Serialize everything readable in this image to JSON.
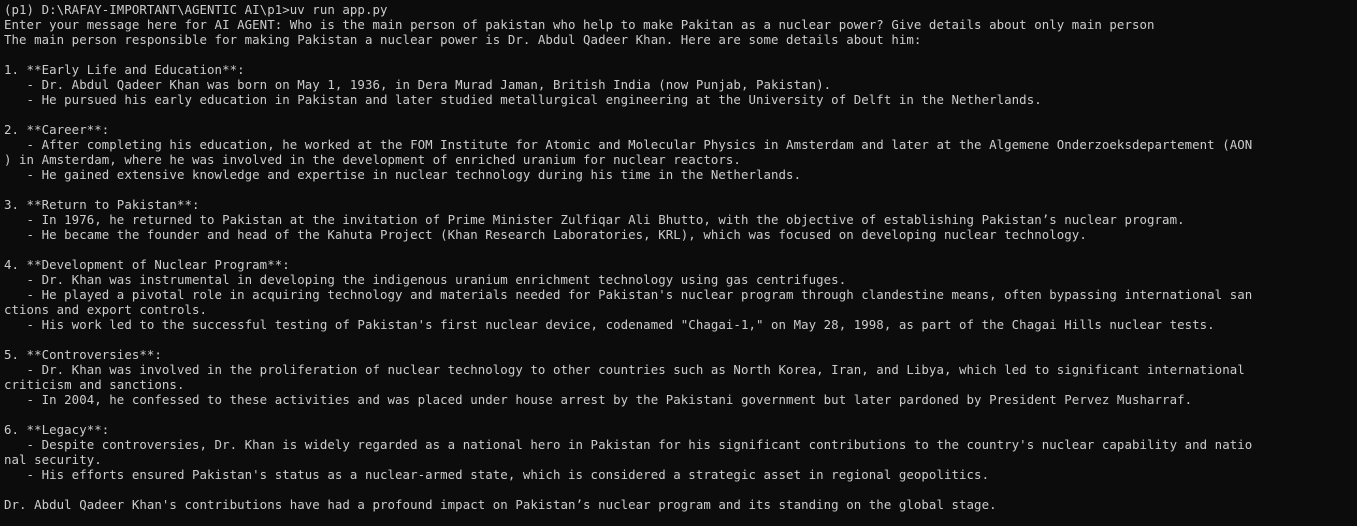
{
  "window": {
    "background": "#0c0c0c",
    "foreground": "#cccccc"
  },
  "lines": [
    "(p1) D:\\RAFAY-IMPORTANT\\AGENTIC AI\\p1>uv run app.py",
    "Enter your message here for AI AGENT: Who is the main person of pakistan who help to make Pakitan as a nuclear power? Give details about only main person",
    "The main person responsible for making Pakistan a nuclear power is Dr. Abdul Qadeer Khan. Here are some details about him:",
    "",
    "1. **Early Life and Education**:",
    "   - Dr. Abdul Qadeer Khan was born on May 1, 1936, in Dera Murad Jaman, British India (now Punjab, Pakistan).",
    "   - He pursued his early education in Pakistan and later studied metallurgical engineering at the University of Delft in the Netherlands.",
    "",
    "2. **Career**:",
    "   - After completing his education, he worked at the FOM Institute for Atomic and Molecular Physics in Amsterdam and later at the Algemene Onderzoeksdepartement (AON",
    ") in Amsterdam, where he was involved in the development of enriched uranium for nuclear reactors.",
    "   - He gained extensive knowledge and expertise in nuclear technology during his time in the Netherlands.",
    "",
    "3. **Return to Pakistan**:",
    "   - In 1976, he returned to Pakistan at the invitation of Prime Minister Zulfiqar Ali Bhutto, with the objective of establishing Pakistan’s nuclear program.",
    "   - He became the founder and head of the Kahuta Project (Khan Research Laboratories, KRL), which was focused on developing nuclear technology.",
    "",
    "4. **Development of Nuclear Program**:",
    "   - Dr. Khan was instrumental in developing the indigenous uranium enrichment technology using gas centrifuges.",
    "   - He played a pivotal role in acquiring technology and materials needed for Pakistan's nuclear program through clandestine means, often bypassing international san",
    "ctions and export controls.",
    "   - His work led to the successful testing of Pakistan's first nuclear device, codenamed \"Chagai-1,\" on May 28, 1998, as part of the Chagai Hills nuclear tests.",
    "",
    "5. **Controversies**:",
    "   - Dr. Khan was involved in the proliferation of nuclear technology to other countries such as North Korea, Iran, and Libya, which led to significant international",
    "criticism and sanctions.",
    "   - In 2004, he confessed to these activities and was placed under house arrest by the Pakistani government but later pardoned by President Pervez Musharraf.",
    "",
    "6. **Legacy**:",
    "   - Despite controversies, Dr. Khan is widely regarded as a national hero in Pakistan for his significant contributions to the country's nuclear capability and natio",
    "nal security.",
    "   - His efforts ensured Pakistan's status as a nuclear-armed state, which is considered a strategic asset in regional geopolitics.",
    "",
    "Dr. Abdul Qadeer Khan's contributions have had a profound impact on Pakistan’s nuclear program and its standing on the global stage."
  ]
}
